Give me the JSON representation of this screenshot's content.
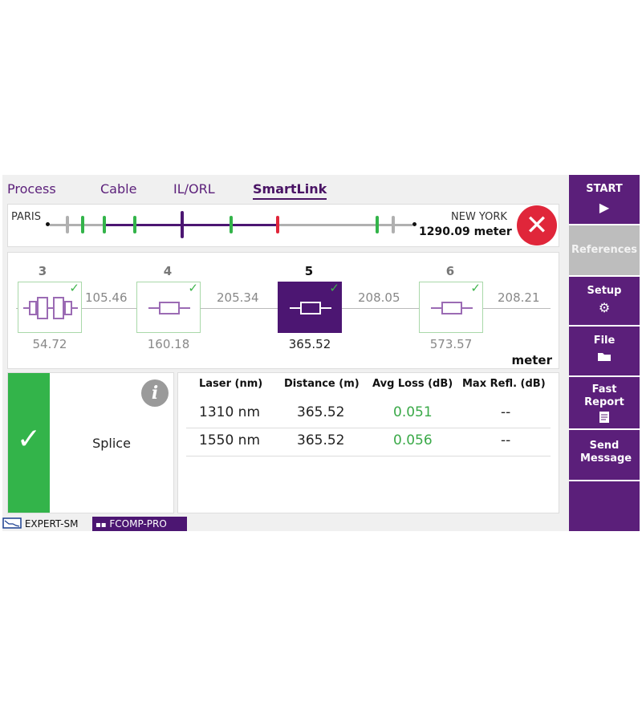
{
  "tabs": [
    {
      "label": "Process",
      "active": false
    },
    {
      "label": "Cable",
      "active": false
    },
    {
      "label": "IL/ORL",
      "active": false
    },
    {
      "label": "SmartLink",
      "active": true
    }
  ],
  "link": {
    "start_site": "PARIS",
    "end_site": "NEW YORK",
    "total_length": "1290.09 meter",
    "status": "fail",
    "colors": {
      "pass": "#33b44a",
      "fail": "#e0263a",
      "selected": "#4c1672",
      "neutral": "#b0b0b0"
    }
  },
  "events": [
    {
      "number": "3",
      "position": "54.72",
      "type_icon": "connector-icon",
      "pass": true,
      "selected": false
    },
    {
      "number": "4",
      "position": "160.18",
      "type_icon": "splice-icon",
      "pass": true,
      "selected": false
    },
    {
      "number": "5",
      "position": "365.52",
      "type_icon": "splice-icon",
      "pass": true,
      "selected": true
    },
    {
      "number": "6",
      "position": "573.57",
      "type_icon": "splice-icon",
      "pass": true,
      "selected": false
    }
  ],
  "segments": [
    "105.46",
    "205.34",
    "208.05",
    "208.21"
  ],
  "unit": "meter",
  "selected_event": {
    "status": "pass",
    "type": "Splice",
    "status_icon": "check-icon",
    "info_icon": "info-icon"
  },
  "results_table": {
    "headers": [
      "Laser (nm)",
      "Distance (m)",
      "Avg Loss (dB)",
      "Max Refl. (dB)"
    ],
    "rows": [
      [
        "1310 nm",
        "365.52",
        "0.051",
        "--"
      ],
      [
        "1550 nm",
        "365.52",
        "0.056",
        "--"
      ]
    ]
  },
  "status_bar": {
    "module": "EXPERT-SM",
    "function": "FCOMP-PRO"
  },
  "side_menu": [
    {
      "label": "START",
      "icon": "play-icon",
      "enabled": true
    },
    {
      "label": "References",
      "icon": "",
      "enabled": false
    },
    {
      "label": "Setup",
      "icon": "gear-icon",
      "enabled": true
    },
    {
      "label": "File",
      "icon": "folder-icon",
      "enabled": true
    },
    {
      "label": "Fast Report",
      "icon": "report-icon",
      "enabled": true
    },
    {
      "label": "Send Message",
      "icon": "",
      "enabled": true
    }
  ]
}
